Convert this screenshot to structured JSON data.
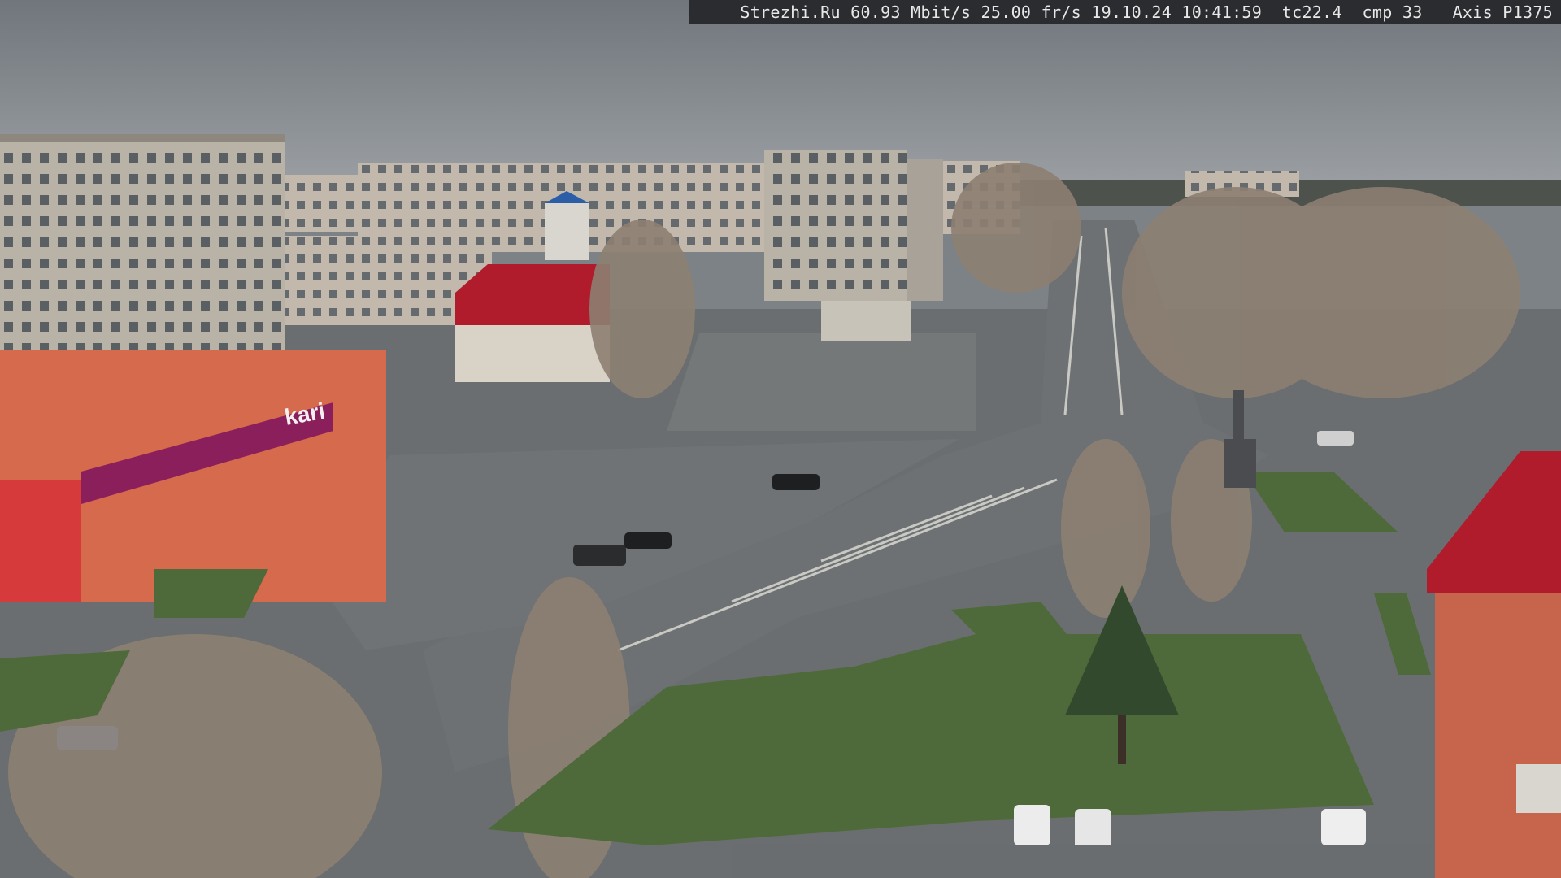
{
  "overlay": {
    "osd_text": "Strezhi.Ru 60.93 Mbit/s 25.00 fr/s 19.10.24 10:41:59  tc22.4  cmp 33   Axis P1375"
  },
  "scene": {
    "store_sign": "kari",
    "colors": {
      "sky": "#7f848a",
      "road": "#6e7174",
      "grass": "#4f6a3a",
      "building_panel": "#b9b2a6",
      "store_facade": "#d66a4c",
      "store_sign": "#8a1f5c",
      "roof_red": "#b01c2c",
      "tree_bare": "#8d7f72",
      "tree_pine": "#33492e"
    }
  }
}
